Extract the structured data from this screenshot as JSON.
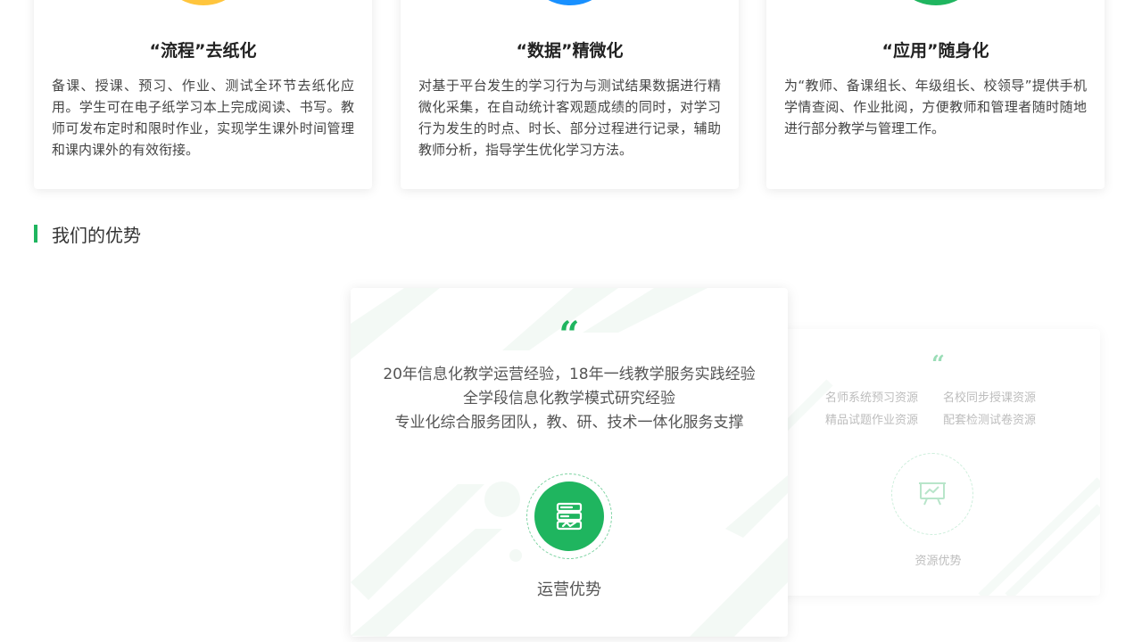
{
  "features": [
    {
      "title": "“流程”去纸化",
      "desc": "备课、授课、预习、作业、测试全环节去纸化应用。学生可在电子纸学习本上完成阅读、书写。教师可发布定时和限时作业，实现学生课外时间管理和课内课外的有效衔接。",
      "circle_color": "#FFC53D"
    },
    {
      "title": "“数据”精微化",
      "desc": "对基于平台发生的学习行为与测试结果数据进行精微化采集，在自动统计客观题成绩的同时，对学习行为发生的时点、时长、部分过程进行记录，辅助教师分析，指导学生优化学习方法。",
      "circle_color": "#1890FF"
    },
    {
      "title": "“应用”随身化",
      "desc": "为“教师、备课组长、年级组长、校领导”提供手机学情查阅、作业批阅，方便教师和管理者随时随地进行部分教学与管理工作。",
      "circle_color": "#1FB55F"
    }
  ],
  "section": {
    "title": "我们的优势",
    "accent_color": "#1FB55F"
  },
  "advantages": {
    "active": {
      "quote": "“",
      "lines": [
        "20年信息化教学运营经验，18年一线教学服务实践经验",
        "全学段信息化教学模式研究经验",
        "专业化综合服务团队，教、研、技术一体化服务支撑"
      ],
      "icon": "operation-icon",
      "label": "运营优势"
    },
    "next": {
      "quote": "“",
      "items": [
        "名师系统预习资源",
        "名校同步授课资源",
        "精品试题作业资源",
        "配套检测试卷资源"
      ],
      "icon": "resource-board-icon",
      "label": "资源优势"
    }
  }
}
